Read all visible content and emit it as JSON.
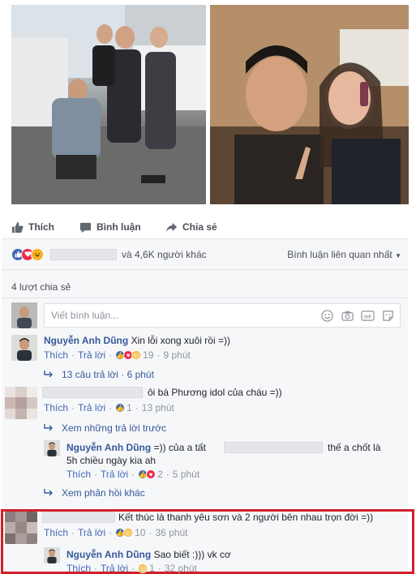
{
  "actions": {
    "like": "Thích",
    "comment": "Bình luận",
    "share": "Chia sẻ"
  },
  "reactions": {
    "summary": "và 4,6K người khác",
    "sort": "Bình luận liên quan nhất",
    "icons": [
      "like-icon",
      "love-icon",
      "haha-icon"
    ]
  },
  "shares": "4 lượt chia sẻ",
  "compose": {
    "placeholder": "Viết bình luận..."
  },
  "comments": [
    {
      "name": "Nguyễn Anh Dũng",
      "text": "Xin lỗi xong xuôi rồi =))",
      "like": "Thích",
      "reply": "Trả lời",
      "count": "19",
      "time": "9 phút",
      "replies_link": "13 câu trả lời · 6 phút"
    },
    {
      "name": "",
      "text": "ôi bà Phương idol của cháu =))",
      "like": "Thích",
      "reply": "Trả lời",
      "count": "1",
      "time": "13 phút",
      "prev_link": "Xem những trả lời trước",
      "reply_item": {
        "name": "Nguyễn Anh Dũng",
        "text_a": "=)) của a tất",
        "text_b": "thế a chốt là",
        "text_c": "5h chiều ngày kia ah",
        "like": "Thích",
        "reply": "Trả lời",
        "count": "2",
        "time": "5 phút"
      },
      "more_link": "Xem phản hồi khác"
    },
    {
      "name": "",
      "text": "Kết thúc là thanh yêu sơn và 2 người bên nhau trọn đời =))",
      "like": "Thích",
      "reply": "Trả lời",
      "count": "10",
      "time": "36 phút",
      "reply_item": {
        "name": "Nguyễn Anh Dũng",
        "text": "Sao biết :))) vk cơ",
        "like": "Thích",
        "reply": "Trả lời",
        "count": "1",
        "time": "32 phút"
      }
    }
  ],
  "colors": {
    "accent": "#4267b2",
    "name": "#365899",
    "highlight": "#d21f2a"
  }
}
